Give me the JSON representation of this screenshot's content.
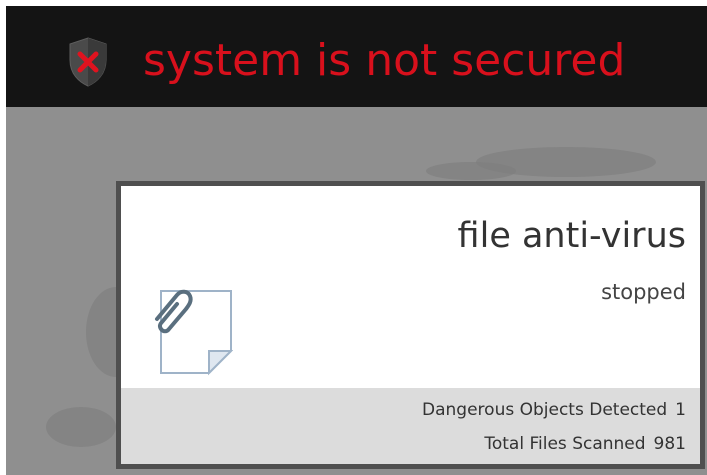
{
  "header": {
    "status_title": "system is not secured",
    "status_icon": "shield-x-icon",
    "title_color": "#d8101c",
    "background_color": "#141414"
  },
  "card": {
    "title": "file anti-virus",
    "status": "stopped",
    "icon": "file-paperclip-icon",
    "stats": [
      {
        "label": "Dangerous Objects Detected",
        "value": "1"
      },
      {
        "label": "Total Files Scanned",
        "value": "981"
      }
    ]
  }
}
